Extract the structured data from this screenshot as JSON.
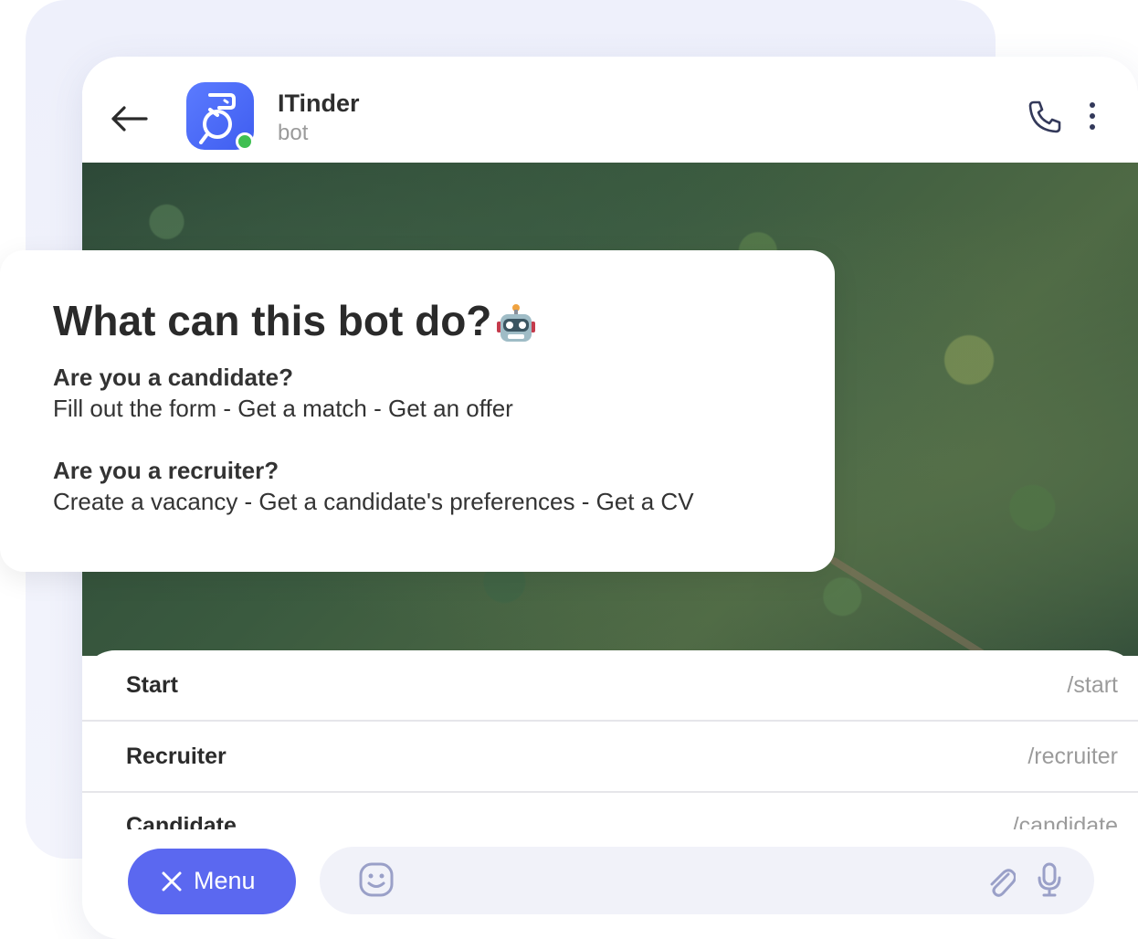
{
  "header": {
    "title": "ITinder",
    "subtitle": "bot",
    "status": "online",
    "back_icon": "arrow-left-icon",
    "call_icon": "phone-icon",
    "more_icon": "more-vertical-icon"
  },
  "info": {
    "title": "What can this bot do?",
    "emoji": "robot-icon",
    "candidate_q": "Are you a candidate?",
    "candidate_a": "Fill out the form - Get a match - Get an offer",
    "recruiter_q": "Are you a recruiter?",
    "recruiter_a": "Create a vacancy - Get a candidate's preferences - Get a CV"
  },
  "commands": [
    {
      "label": "Start",
      "command": "/start"
    },
    {
      "label": "Recruiter",
      "command": "/recruiter"
    },
    {
      "label": "Candidate",
      "command": "/candidate"
    }
  ],
  "bottom": {
    "menu_label": "Menu",
    "menu_icon": "close-icon",
    "emoji_icon": "smile-icon",
    "attach_icon": "paperclip-icon",
    "mic_icon": "microphone-icon"
  },
  "colors": {
    "accent": "#5b68f0",
    "avatar": "#4a66f5",
    "online": "#3fbf52",
    "back_card": "#eef0fb"
  }
}
